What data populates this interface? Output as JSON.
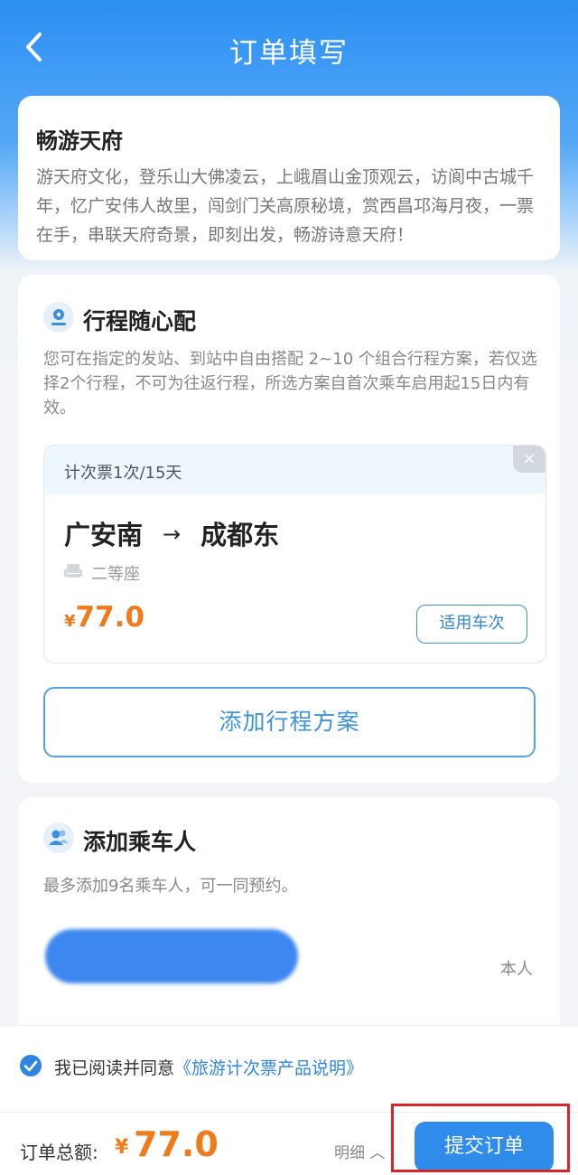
{
  "nav": {
    "title": "订单填写"
  },
  "intro": {
    "title": "畅游天府",
    "text": "游天府文化，登乐山大佛凌云，上峨眉山金顶观云，访阆中古城千年，忆广安伟人故里，闯剑门关高原秘境，赏西昌邛海月夜，一票在手，串联天府奇景，即刻出发，畅游诗意天府！"
  },
  "trip": {
    "title": "行程随心配",
    "desc": "您可在指定的发站、到站中自由搭配 2~10 个组合行程方案，若仅选择2个行程，不可为往返行程，所选方案自首次乘车启用起15日内有效。",
    "ticket": {
      "type": "计次票1次/15天",
      "close": "×",
      "from": "广安南",
      "arrow": "→",
      "to": "成都东",
      "seat": "二等座",
      "currency": "¥",
      "price": "77.0",
      "routes_button": "适用车次"
    },
    "add_button": "添加行程方案"
  },
  "passenger": {
    "title": "添加乘车人",
    "desc": "最多添加9名乘车人，可一同预约。",
    "relation": "本人"
  },
  "agreement": {
    "prefix": "我已阅读并同意",
    "link": "《旅游计次票产品说明》"
  },
  "footer": {
    "total_label": "订单总额:",
    "currency": "¥",
    "total": "77.0",
    "detail": "明细 ︿",
    "submit": "提交订单"
  },
  "colors": {
    "primary": "#2f8cea",
    "price": "#f07b1a",
    "highlight": "#d9262c"
  }
}
